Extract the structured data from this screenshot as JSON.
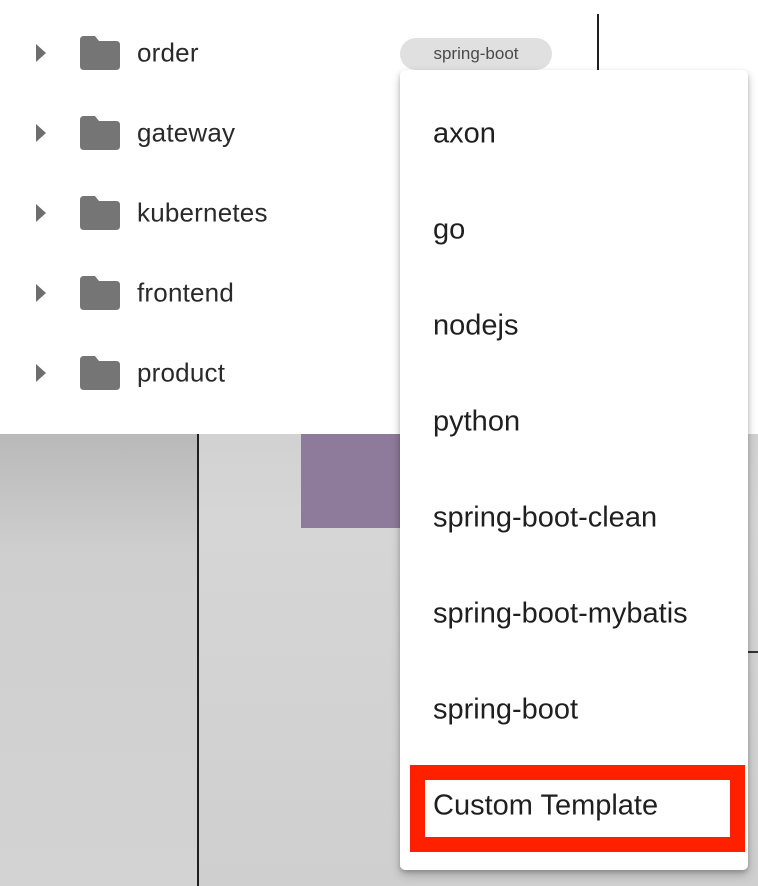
{
  "tree": {
    "items": [
      {
        "label": "order",
        "icon": "folder-icon",
        "expander_icon": "caret-right-icon"
      },
      {
        "label": "gateway",
        "icon": "folder-icon",
        "expander_icon": "caret-right-icon"
      },
      {
        "label": "kubernetes",
        "icon": "folder-icon",
        "expander_icon": "caret-right-icon"
      },
      {
        "label": "frontend",
        "icon": "folder-icon",
        "expander_icon": "caret-right-icon"
      },
      {
        "label": "product",
        "icon": "folder-icon",
        "expander_icon": "caret-right-icon"
      }
    ],
    "selected_template_chip": "spring-boot"
  },
  "template_menu": {
    "options": [
      "axon",
      "go",
      "nodejs",
      "python",
      "spring-boot-clean",
      "spring-boot-mybatis",
      "spring-boot",
      "Custom Template"
    ],
    "highlighted_option": "Custom Template"
  },
  "colors": {
    "folder": "#757575",
    "highlight": "#ff2000",
    "chip_bg": "#e0e0e0"
  }
}
